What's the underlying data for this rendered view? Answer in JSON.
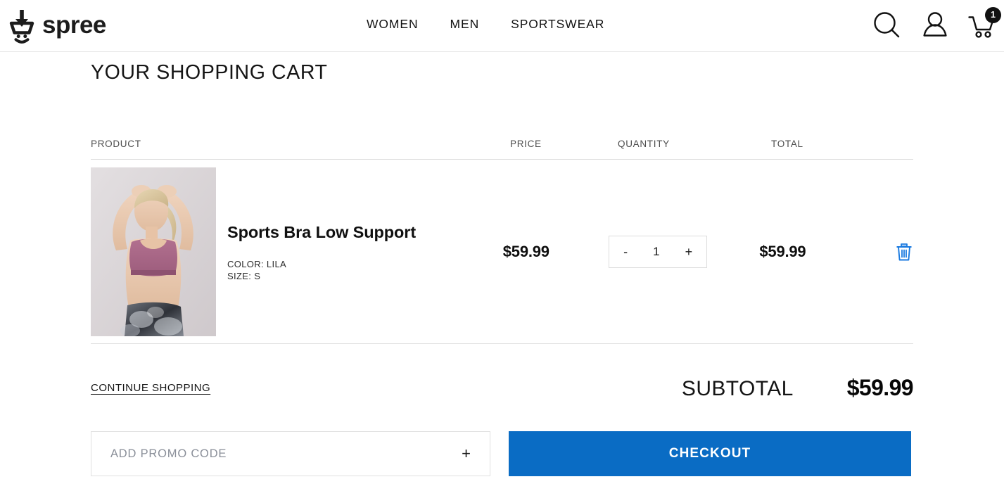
{
  "brand": {
    "name": "spree",
    "logo_icon": "spree-cart-smiley-logo"
  },
  "nav": {
    "items": [
      {
        "label": "WOMEN"
      },
      {
        "label": "MEN"
      },
      {
        "label": "SPORTSWEAR"
      }
    ]
  },
  "header_icons": {
    "search": "search-icon",
    "account": "user-icon",
    "cart": "shopping-cart-icon",
    "cart_count": "1"
  },
  "page": {
    "title": "YOUR SHOPPING CART"
  },
  "table": {
    "headers": {
      "product": "PRODUCT",
      "price": "PRICE",
      "quantity": "QUANTITY",
      "total": "TOTAL"
    }
  },
  "line_item": {
    "name": "Sports Bra Low Support",
    "color_line": "COLOR: LILA",
    "size_line": "SIZE: S",
    "price": "$59.99",
    "quantity": "1",
    "decrement_label": "-",
    "increment_label": "+",
    "total": "$59.99",
    "remove_icon": "trash-icon",
    "image_alt": "Sports Bra Low Support product photo"
  },
  "summary": {
    "continue_shopping": "CONTINUE SHOPPING",
    "subtotal_label": "SUBTOTAL",
    "subtotal_value": "$59.99"
  },
  "footer_actions": {
    "promo_placeholder": "ADD PROMO CODE",
    "promo_value": "",
    "promo_expand_label": "+",
    "checkout_label": "CHECKOUT"
  },
  "colors": {
    "accent_blue": "#0a6cc4",
    "trash_blue": "#1a7ae0",
    "text": "#111111",
    "muted": "#8a8f99",
    "border": "#e0e0e0"
  }
}
